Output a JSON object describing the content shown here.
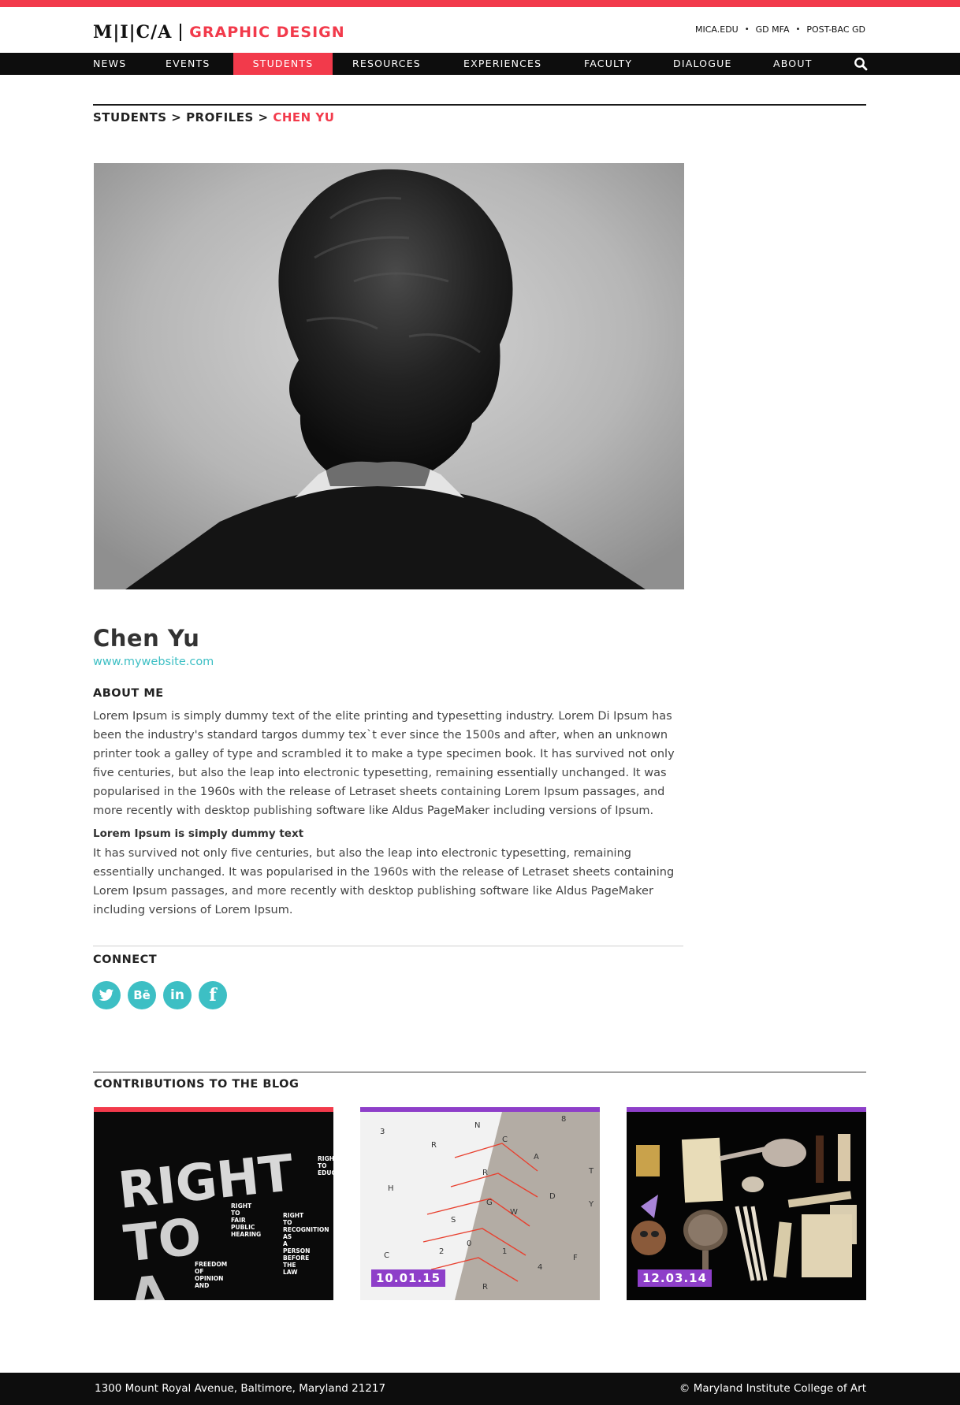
{
  "colors": {
    "accent": "#f23a4b",
    "link": "#3dbfc4",
    "nav_bg": "#0d0d0d",
    "badge_purple": "#8e3fc9"
  },
  "brand": {
    "logo": "M|I|C/A",
    "section": "GRAPHIC DESIGN"
  },
  "util_links": [
    "MICA.EDU",
    "GD MFA",
    "POST-BAC GD"
  ],
  "nav": {
    "items": [
      {
        "label": "NEWS"
      },
      {
        "label": "EVENTS"
      },
      {
        "label": "STUDENTS",
        "active": true
      },
      {
        "label": "RESOURCES"
      },
      {
        "label": "EXPERIENCES"
      },
      {
        "label": "FACULTY"
      },
      {
        "label": "DIALOGUE"
      },
      {
        "label": "ABOUT"
      }
    ],
    "search_icon": "search-icon"
  },
  "breadcrumb": {
    "level1": "STUDENTS",
    "level2": "PROFILES",
    "current": "CHEN YU",
    "separator": ">"
  },
  "profile": {
    "name": "Chen Yu",
    "website": "www.mywebsite.com",
    "about_heading": "ABOUT ME",
    "about_text": "Lorem Ipsum is simply dummy text of the elite printing and typesetting industry. Lorem Di Ipsum has been the industry's standard targos dummy tex`t ever since the 1500s and after, when an unknown printer took a galley of type and scrambled it to make a type specimen book. It has survived not only five centuries, but also the leap into electronic typesetting, remaining essentially unchanged. It was popularised in the 1960s with the release of Letraset sheets containing Lorem Ipsum passages, and more recently with desktop publishing software like Aldus PageMaker including versions of Ipsum.",
    "subheading": "Lorem Ipsum is simply dummy text",
    "sub_text": "It has survived not only five centuries, but also the leap into electronic typesetting, remaining essentially unchanged. It was popularised in the 1960s with the release of Letraset sheets containing Lorem Ipsum passages, and more recently with desktop publishing software like Aldus PageMaker including versions of Lorem Ipsum."
  },
  "connect": {
    "heading": "CONNECT",
    "icons": [
      "twitter-icon",
      "behance-icon",
      "linkedin-icon",
      "facebook-icon"
    ]
  },
  "blog": {
    "heading": "CONTRIBUTIONS TO THE BLOG",
    "cards": [
      {
        "date": "",
        "stripe": "#f23a4b",
        "title_art": "RIGHT TO A",
        "poster_lines": [
          "RIGHT",
          "TO",
          "FAIR",
          "PUBLIC",
          "HEARING"
        ],
        "poster_lines_2": [
          "RIGHT",
          "TO",
          "RECOGNITION",
          "AS",
          "A",
          "PERSON",
          "BEFORE",
          "THE",
          "LAW"
        ],
        "poster_lines_3": [
          "FREEDOM",
          "OF",
          "OPINION",
          "AND"
        ],
        "poster_corner": [
          "RIGHT",
          "TO",
          "EDUC"
        ]
      },
      {
        "date": "10.01.15",
        "stripe": "#8e3fc9"
      },
      {
        "date": "12.03.14",
        "stripe": "#8e3fc9"
      }
    ]
  },
  "footer": {
    "address": "1300 Mount Royal Avenue, Baltimore, Maryland 21217",
    "copyright": "© Maryland Institute College of Art"
  }
}
